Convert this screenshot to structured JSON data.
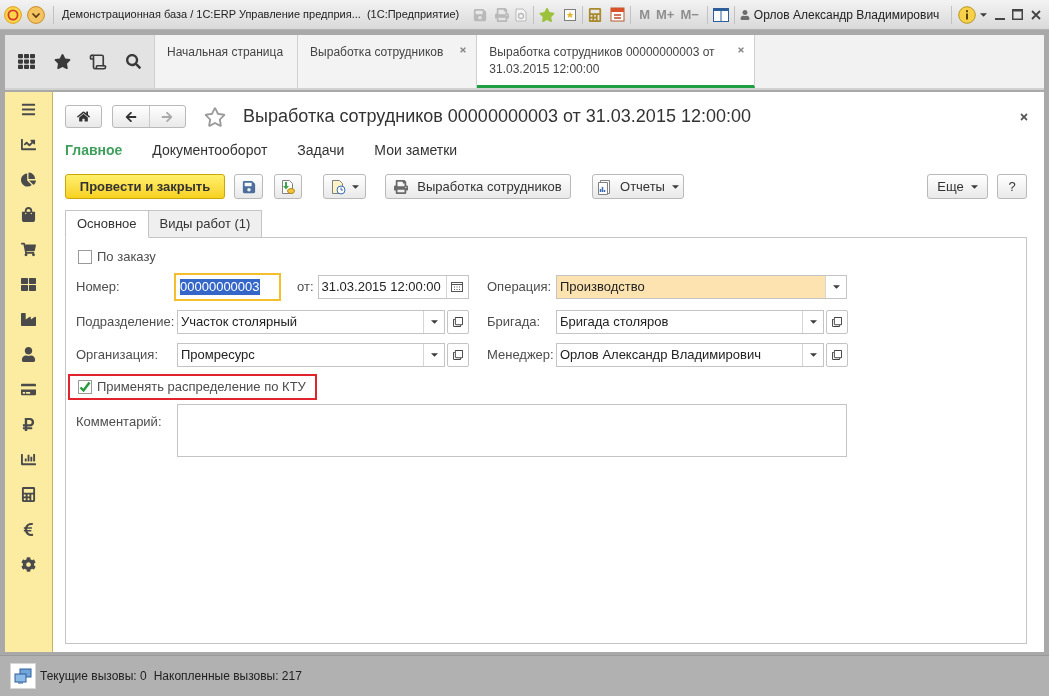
{
  "window": {
    "title": "Демонстрационная база / 1С:ERP Управление предприя...  (1С:Предприятие)",
    "memory_buttons": [
      {
        "label": "M",
        "disabled": true
      },
      {
        "label": "M+",
        "disabled": true
      },
      {
        "label": "M−",
        "disabled": true
      }
    ],
    "user": "Орлов Александр Владимирович"
  },
  "open_tabs": [
    {
      "label": "Начальная страница",
      "selected": false,
      "closable": false
    },
    {
      "label": "Выработка сотрудников",
      "selected": false,
      "closable": true
    },
    {
      "label": "Выработка сотрудников 00000000003 от 31.03.2015 12:00:00",
      "selected": true,
      "closable": true
    }
  ],
  "form": {
    "title": "Выработка сотрудников 00000000003 от 31.03.2015 12:00:00",
    "sections": [
      {
        "label": "Главное",
        "selected": true
      },
      {
        "label": "Документооборот",
        "selected": false
      },
      {
        "label": "Задачи",
        "selected": false
      },
      {
        "label": "Мои заметки",
        "selected": false
      }
    ],
    "toolbar": {
      "post_and_close": "Провести и закрыть",
      "print": "Выработка сотрудников",
      "reports": "Отчеты",
      "more": "Еще",
      "help": "?"
    },
    "tabs": [
      {
        "label": "Основное",
        "selected": true
      },
      {
        "label": "Виды работ (1)",
        "selected": false
      }
    ],
    "by_order": {
      "label": "По заказу",
      "checked": false
    },
    "number": {
      "label": "Номер:",
      "value": "00000000003",
      "focused": true
    },
    "date": {
      "label": "от:",
      "value": "31.03.2015 12:00:00"
    },
    "operation": {
      "label": "Операция:",
      "value": "Производство",
      "highlighted": true
    },
    "department": {
      "label": "Подразделение:",
      "value": "Участок столярный"
    },
    "brigade": {
      "label": "Бригада:",
      "value": "Бригада столяров"
    },
    "organization": {
      "label": "Организация:",
      "value": "Промресурс"
    },
    "manager": {
      "label": "Менеджер:",
      "value": "Орлов Александр Владимирович"
    },
    "ktu": {
      "label": "Применять распределение по КТУ",
      "checked": true,
      "framed": true
    },
    "comment": {
      "label": "Комментарий:"
    }
  },
  "status_bar": {
    "current_calls": "Текущие вызовы: 0",
    "accumulated_calls": "Накопленные вызовы: 217"
  }
}
